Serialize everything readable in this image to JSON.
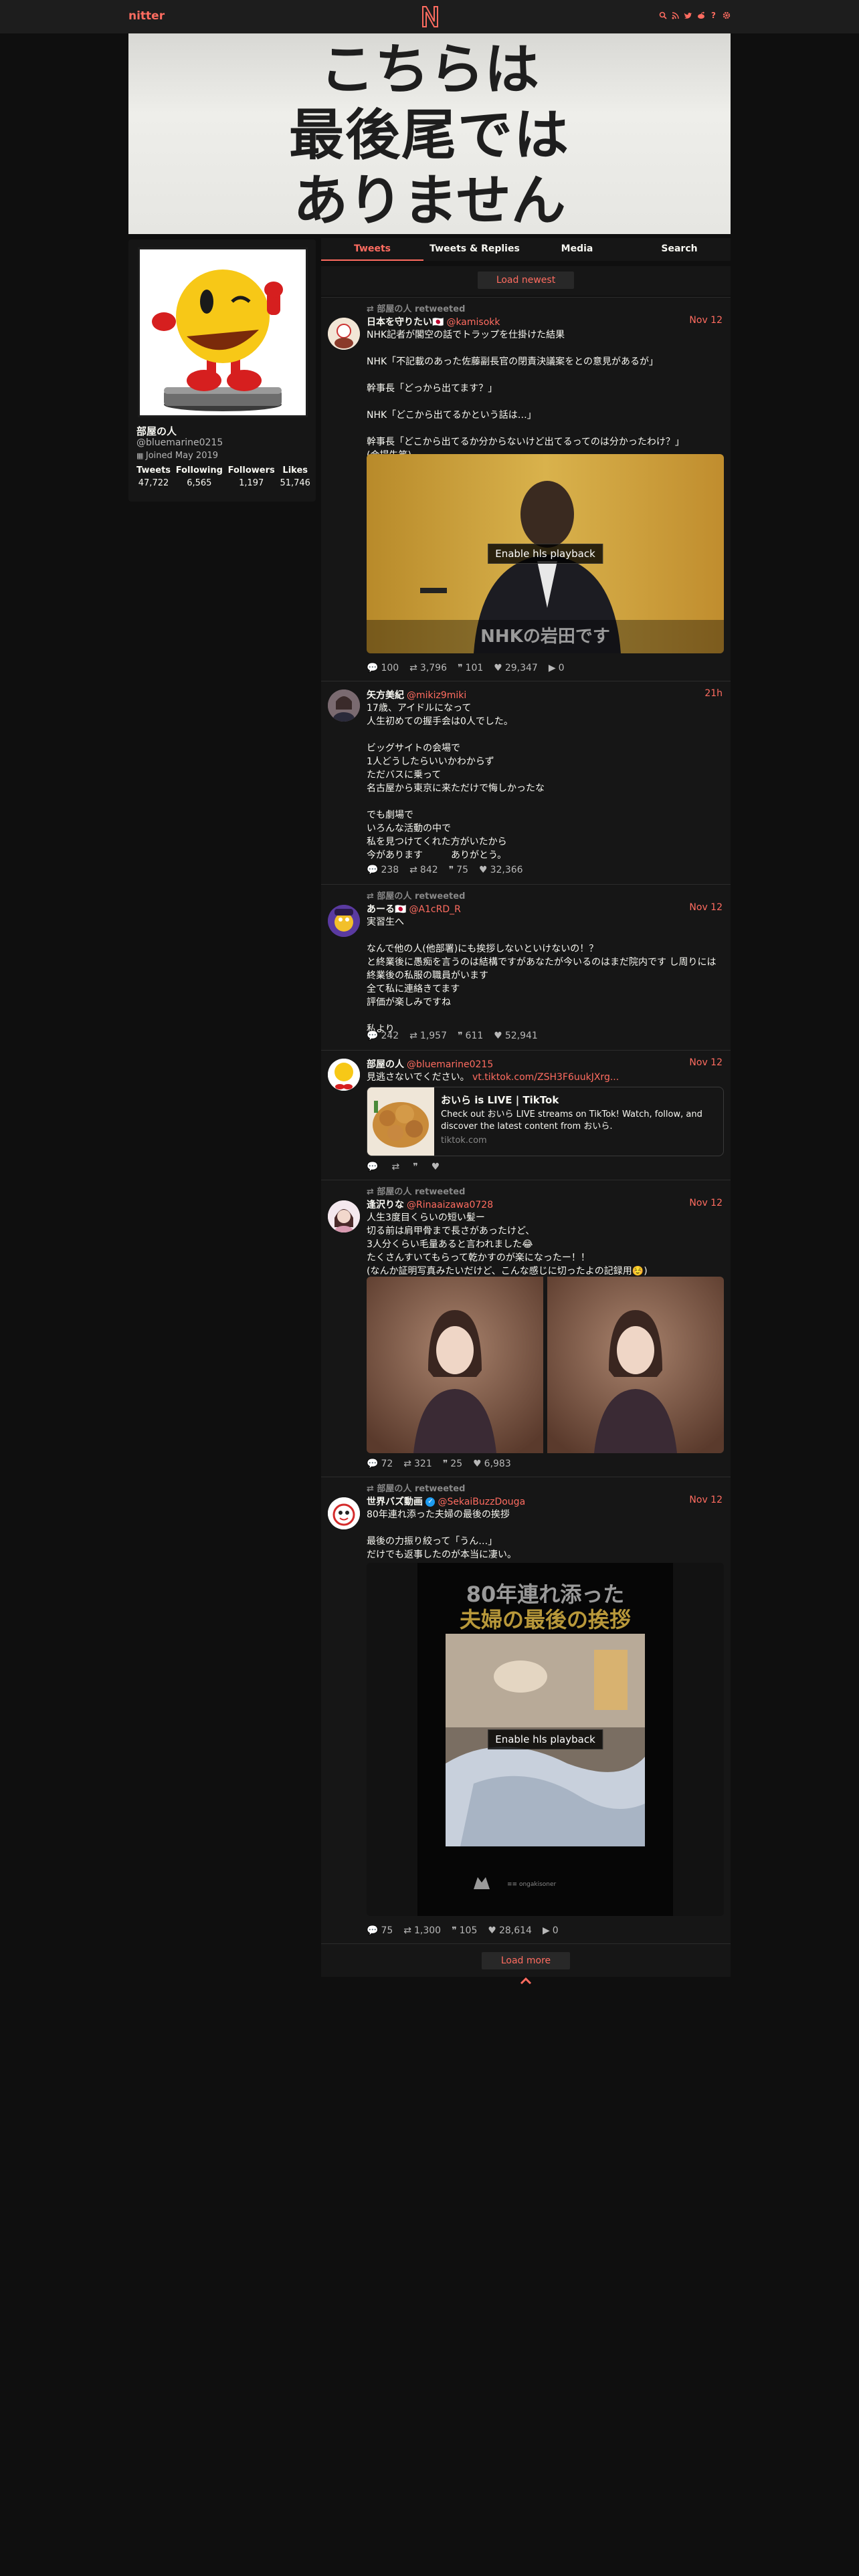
{
  "nav": {
    "brand": "nitter",
    "icons": [
      "search-icon",
      "rss-icon",
      "twitter-icon",
      "reddit-icon",
      "info-icon",
      "gear-icon"
    ],
    "info_glyph": "?"
  },
  "banner": {
    "lines": [
      "こちらは",
      "最後尾では",
      "ありません"
    ]
  },
  "profile": {
    "name": "部屋の人",
    "handle": "@bluemarine0215",
    "joined": "Joined May 2019",
    "stats": [
      {
        "label": "Tweets",
        "value": "47,722"
      },
      {
        "label": "Following",
        "value": "6,565"
      },
      {
        "label": "Followers",
        "value": "1,197"
      },
      {
        "label": "Likes",
        "value": "51,746"
      }
    ]
  },
  "tabs": [
    "Tweets",
    "Tweets & Replies",
    "Media",
    "Search"
  ],
  "load_newest": "Load newest",
  "load_more": "Load more",
  "video_overlay": "Enable hls playback",
  "tweets": [
    {
      "retweet": "部屋の人 retweeted",
      "name": "日本を守りたい🇯🇵",
      "handle": "@kamisokk",
      "date": "Nov 12",
      "text": "NHK記者が閣空の話でトラップを仕掛けた結果\n\nNHK「不記載のあった佐藤副長官の閉責決議案をとの意見があるが」\n\n幹事長「どっから出てます？」\n\nNHK「どこから出てるかという話は…」\n\n幹事長「どこから出てるか分からないけど出てるってのは分かったわけ？」\n(会場失笑)",
      "caption": "NHKの岩田です",
      "stats": {
        "replies": "100",
        "retweets": "3,796",
        "quotes": "101",
        "likes": "29,347",
        "views": "0"
      }
    },
    {
      "retweet": "",
      "name": "矢方美紀",
      "handle": "@mikiz9miki",
      "date": "21h",
      "text": "17歳、アイドルになって\n人生初めての握手会は0人でした。\n\nビッグサイトの会場で\n1人どうしたらいいかわからず\nただバスに乗って\n名古屋から東京に来ただけで悔しかったな\n\nでも劇場で\nいろんな活動の中で\n私を見つけてくれた方がいたから\n今があります　　　ありがとう。",
      "stats": {
        "replies": "238",
        "retweets": "842",
        "quotes": "75",
        "likes": "32,366"
      }
    },
    {
      "retweet": "部屋の人 retweeted",
      "name": "あーる🇯🇵",
      "handle": "@A1cRD_R",
      "date": "Nov 12",
      "text": "実習生へ\n\nなんで他の人(他部署)にも挨拶しないといけないの！？\nと終業後に愚痴を言うのは結構ですがあなたが今いるのはまだ院内です し周りには終業後の私服の職員がいます\n全て私に連絡きてます\n評価が楽しみですね\n\n私より",
      "stats": {
        "replies": "242",
        "retweets": "1,957",
        "quotes": "611",
        "likes": "52,941"
      }
    },
    {
      "retweet": "",
      "name": "部屋の人",
      "handle": "@bluemarine0215",
      "date": "Nov 12",
      "text_prefix": "見逃さないでください。",
      "link": "vt.tiktok.com/ZSH3F6uukJXrg...",
      "card": {
        "title": "おいら is LIVE | TikTok",
        "desc": "Check out おいら LIVE streams on TikTok! Watch, follow, and discover the latest content from おいら.",
        "dest": "tiktok.com"
      },
      "stats": {
        "replies": "",
        "retweets": "",
        "quotes": "",
        "likes": ""
      }
    },
    {
      "retweet": "部屋の人 retweeted",
      "name": "逢沢りな",
      "handle": "@Rinaaizawa0728",
      "date": "Nov 12",
      "text": "人生3度目くらいの短い髪ー\n切る前は肩甲骨まで長さがあったけど、\n3人分くらい毛量あると言われました😂\nたくさんすいてもらって乾かすのが楽になったー！！\n(なんか証明写真みたいだけど、こんな感じに切ったよの記録用☺️)",
      "stats": {
        "replies": "72",
        "retweets": "321",
        "quotes": "25",
        "likes": "6,983"
      }
    },
    {
      "retweet": "部屋の人 retweeted",
      "name": "世界バズ動画",
      "handle": "@SekaiBuzzDouga",
      "date": "Nov 12",
      "text": "80年連れ添った夫婦の最後の挨拶\n\n最後の力振り絞って「うん…」\nだけでも返事したのが本当に凄い。",
      "caption_line1": "80年連れ添った",
      "caption_line2": "夫婦の最後の挨拶",
      "watermark": "≡≡ ongakisoner",
      "stats": {
        "replies": "75",
        "retweets": "1,300",
        "quotes": "105",
        "likes": "28,614",
        "views": "0"
      }
    }
  ]
}
